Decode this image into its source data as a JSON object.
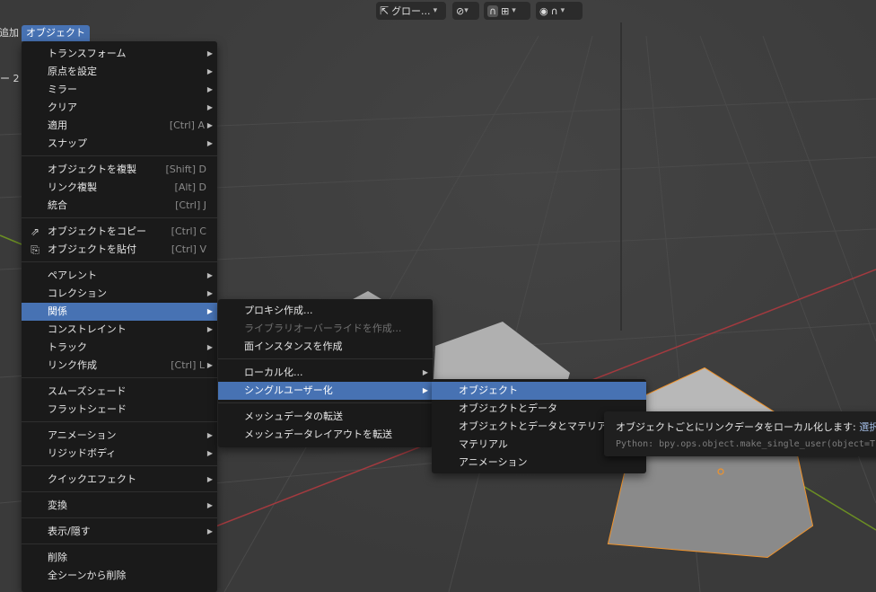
{
  "header": {
    "transform_orientation": "グロー...",
    "snap_label": "",
    "proportional_label": ""
  },
  "menubar": {
    "prev_item": "追加",
    "active_item": "オブジェクト"
  },
  "viewport_overlay": {
    "left_text": "ー 2"
  },
  "object_menu": {
    "items": [
      {
        "label": "トランスフォーム",
        "shortcut": "",
        "submenu": true
      },
      {
        "label": "原点を設定",
        "shortcut": "",
        "submenu": true
      },
      {
        "label": "ミラー",
        "shortcut": "",
        "submenu": true
      },
      {
        "label": "クリア",
        "shortcut": "",
        "submenu": true
      },
      {
        "label": "適用",
        "shortcut": "[Ctrl] A",
        "submenu": true
      },
      {
        "label": "スナップ",
        "shortcut": "",
        "submenu": true
      },
      {
        "label": "オブジェクトを複製",
        "shortcut": "[Shift] D",
        "submenu": false
      },
      {
        "label": "リンク複製",
        "shortcut": "[Alt] D",
        "submenu": false
      },
      {
        "label": "統合",
        "shortcut": "[Ctrl] J",
        "submenu": false
      },
      {
        "label": "オブジェクトをコピー",
        "shortcut": "[Ctrl] C",
        "submenu": false
      },
      {
        "label": "オブジェクトを貼付",
        "shortcut": "[Ctrl] V",
        "submenu": false
      },
      {
        "label": "ペアレント",
        "shortcut": "",
        "submenu": true
      },
      {
        "label": "コレクション",
        "shortcut": "",
        "submenu": true
      },
      {
        "label": "関係",
        "shortcut": "",
        "submenu": true
      },
      {
        "label": "コンストレイント",
        "shortcut": "",
        "submenu": true
      },
      {
        "label": "トラック",
        "shortcut": "",
        "submenu": true
      },
      {
        "label": "リンク作成",
        "shortcut": "[Ctrl] L",
        "submenu": true
      },
      {
        "label": "スムーズシェード",
        "shortcut": "",
        "submenu": false
      },
      {
        "label": "フラットシェード",
        "shortcut": "",
        "submenu": false
      },
      {
        "label": "アニメーション",
        "shortcut": "",
        "submenu": true
      },
      {
        "label": "リジッドボディ",
        "shortcut": "",
        "submenu": true
      },
      {
        "label": "クイックエフェクト",
        "shortcut": "",
        "submenu": true
      },
      {
        "label": "変換",
        "shortcut": "",
        "submenu": true
      },
      {
        "label": "表示/隠す",
        "shortcut": "",
        "submenu": true
      },
      {
        "label": "削除",
        "shortcut": "",
        "submenu": false
      },
      {
        "label": "全シーンから削除",
        "shortcut": "",
        "submenu": false
      }
    ]
  },
  "relations_menu": {
    "items": [
      {
        "label": "プロキシ作成...",
        "submenu": false,
        "disabled": false
      },
      {
        "label": "ライブラリオーバーライドを作成...",
        "submenu": false,
        "disabled": true
      },
      {
        "label": "面インスタンスを作成",
        "submenu": false,
        "disabled": false
      },
      {
        "label": "ローカル化...",
        "submenu": true,
        "disabled": false
      },
      {
        "label": "シングルユーザー化",
        "submenu": true,
        "disabled": false
      },
      {
        "label": "メッシュデータの転送",
        "submenu": false,
        "disabled": false
      },
      {
        "label": "メッシュデータレイアウトを転送",
        "submenu": false,
        "disabled": false
      }
    ]
  },
  "single_user_menu": {
    "items": [
      {
        "label": "オブジェクト"
      },
      {
        "label": "オブジェクトとデータ"
      },
      {
        "label": "オブジェクトとデータとマテリアル"
      },
      {
        "label": "マテリアル"
      },
      {
        "label": "アニメーション"
      }
    ]
  },
  "tooltip": {
    "description": "オブジェクトごとにリンクデータをローカル化します: ",
    "description_rest": "選択",
    "python": "Python: bpy.ops.object.make_single_user(object=T"
  },
  "colors": {
    "highlight": "#4772b3",
    "menu_bg": "#1a1a1a",
    "selection_outline": "#f0932b",
    "x_axis": "#a33a3f",
    "y_axis": "#6b8e23"
  }
}
